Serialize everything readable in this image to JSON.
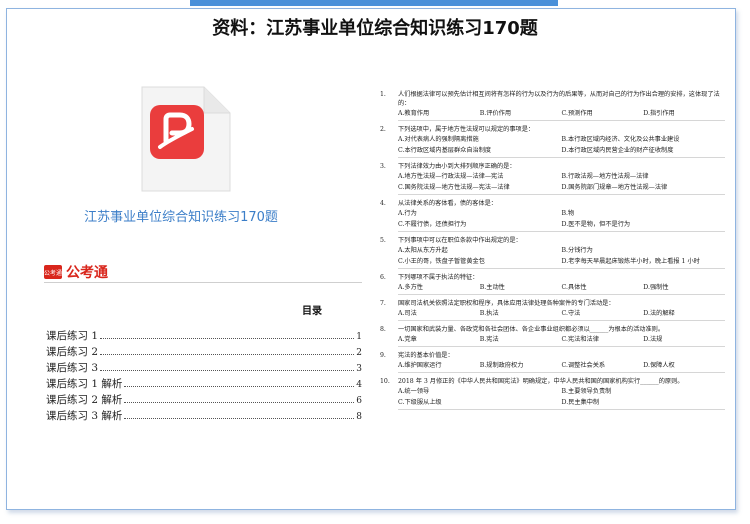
{
  "title": "资料：江苏事业单位综合知识练习170题",
  "file": {
    "name": "江苏事业单位综合知识练习170题",
    "icon": "wps-pdf-file-icon"
  },
  "brand": {
    "logo_text": "公考通",
    "name": "公考通"
  },
  "toc": {
    "title": "目录",
    "items": [
      {
        "label": "课后练习 1",
        "page": "1"
      },
      {
        "label": "课后练习 2",
        "page": "2"
      },
      {
        "label": "课后练习 3",
        "page": "3"
      },
      {
        "label": "课后练习 1 解析",
        "page": "4"
      },
      {
        "label": "课后练习 2 解析",
        "page": "6"
      },
      {
        "label": "课后练习 3 解析",
        "page": "8"
      }
    ]
  },
  "questions": [
    {
      "num": "1.",
      "text": "人们根据法律可以预先估计相互间将有怎样的行为以及行为的后果等，从而对自己的行为作出合理的安排，这体现了法的：",
      "cols": 4,
      "options": [
        "A.教育作用",
        "B.评价作用",
        "C.预测作用",
        "D.指引作用"
      ]
    },
    {
      "num": "2.",
      "text": "下列选项中，属于地方性法规可以规定的事项是：",
      "cols": 2,
      "options": [
        "A.对代表病人的强制隔离措施",
        "B.本行政区域内经济、文化及公共事业建设",
        "C.本行政区域内基层群众自治制度",
        "D.本行政区域内民营企业的财产征收制度"
      ]
    },
    {
      "num": "3.",
      "text": "下列法律效力由小到大排列顺序正确的是：",
      "cols": 2,
      "options": [
        "A.地方性法规—行政法规—法律—宪法",
        "B.行政法规—地方性法规—法律",
        "C.国务院法规—地方性法规—宪法—法律",
        "D.国务院部门规章—地方性法规—法律"
      ]
    },
    {
      "num": "4.",
      "text": "从法律关系的客体看，债的客体是：",
      "cols": 2,
      "options": [
        "A.行为",
        "B.物",
        "C.不履行债，还债担行为",
        "D.医不是物，但不是行为"
      ]
    },
    {
      "num": "5.",
      "text": "下列事项中可以在职位条款中作出规定的是：",
      "cols": 2,
      "options": [
        "A.太阳从东方升起",
        "B.分钱行为",
        "C.小王的哥，铁盘子暂管黄金包",
        "D.老李每天早晨起床锻炼半小时，晚上看报 1 小时"
      ]
    },
    {
      "num": "6.",
      "text": "下列哪项不属于执法的特征：",
      "cols": 4,
      "options": [
        "A.多方性",
        "B.主动性",
        "C.具体性",
        "D.强制性"
      ]
    },
    {
      "num": "7.",
      "text": "国家司法机关依照法定职权和程序，具体应用法律处理各种案件的专门活动是：",
      "cols": 4,
      "options": [
        "A.司法",
        "B.执法",
        "C.守法",
        "D.法的解释"
      ]
    },
    {
      "num": "8.",
      "text": "一切国家和武装力量、各政党和各社会团体、各企业事业组织都必须以______为根本的活动准则。",
      "cols": 4,
      "options": [
        "A.党章",
        "B.宪法",
        "C.宪法和法律",
        "D.法规"
      ]
    },
    {
      "num": "9.",
      "text": "宪法的基本价值是：",
      "cols": 4,
      "options": [
        "A.维护国家运行",
        "B.规制政府权力",
        "C.调整社会关系",
        "D.保障人权"
      ]
    },
    {
      "num": "10.",
      "text": "2018 年 3 月修正的《中华人民共和国宪法》明确规定，中华人民共和国的国家机构实行______的原则。",
      "cols": 2,
      "options": [
        "A.统一领导",
        "B.主要领导负责制",
        "C.下级服从上级",
        "D.民主集中制"
      ]
    }
  ]
}
